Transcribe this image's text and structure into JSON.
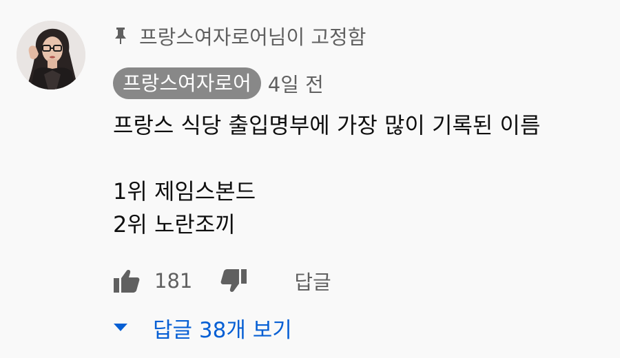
{
  "comment": {
    "pinned_label": "프랑스여자로어님이 고정함",
    "author": "프랑스여자로어",
    "timestamp": "4일 전",
    "body": "프랑스 식당 출입명부에 가장 많이 기록된 이름\n\n1위 제임스본드\n2위 노란조끼",
    "like_count": "181",
    "reply_label": "답글",
    "view_replies_label": "답글 38개 보기"
  },
  "icons": {
    "pin": "pin-icon",
    "like": "thumbs-up-icon",
    "dislike": "thumbs-down-icon",
    "expand": "caret-down-icon"
  },
  "colors": {
    "background": "#f9f9f9",
    "author_chip": "#888888",
    "secondary_text": "#606060",
    "link_blue": "#065fd4"
  }
}
